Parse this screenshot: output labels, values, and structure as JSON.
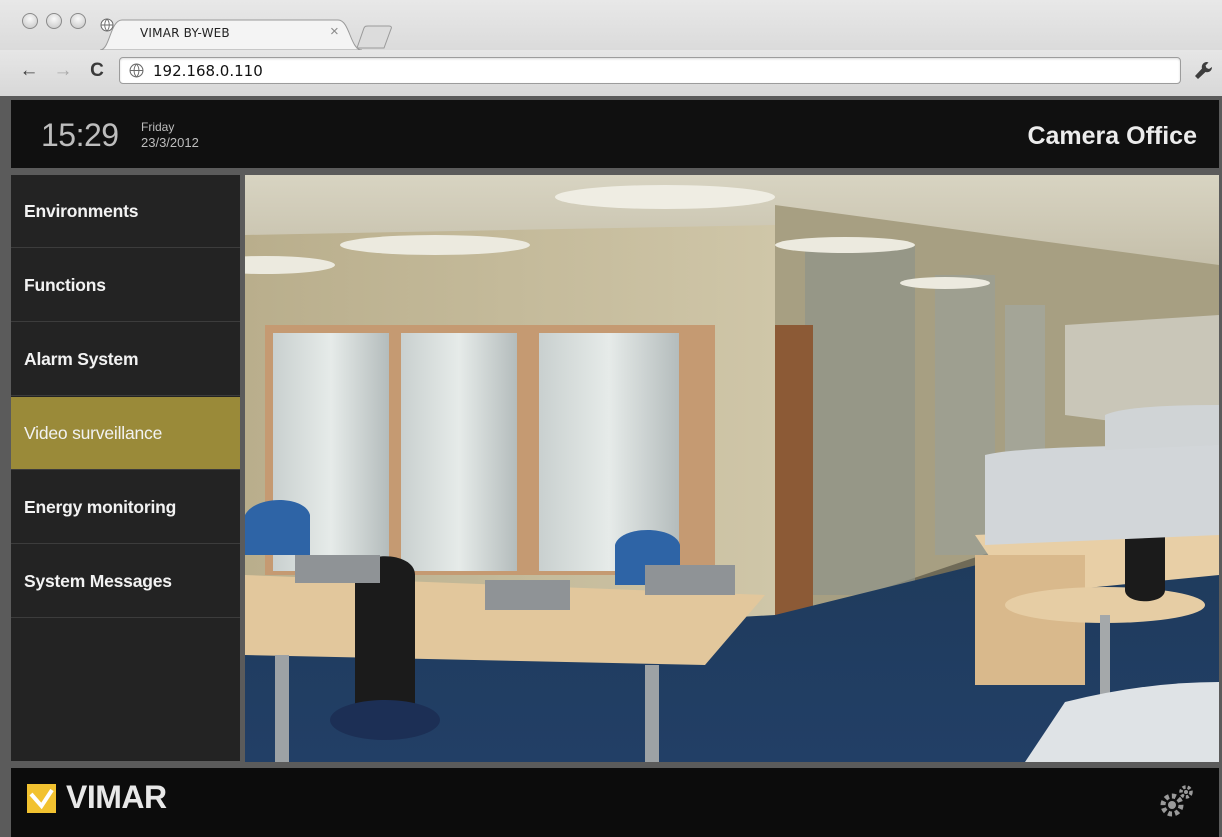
{
  "browser": {
    "tab_title": "VIMAR BY-WEB",
    "tab_close": "×",
    "url": "192.168.0.110",
    "back": "←",
    "forward": "→",
    "reload": "C",
    "icons": [
      "globe-icon",
      "wrench-icon",
      "back-arrow-icon",
      "forward-arrow-icon",
      "reload-icon"
    ]
  },
  "header": {
    "time": "15:29",
    "day": "Friday",
    "date": "23/3/2012",
    "title": "Camera Office"
  },
  "sidebar": {
    "items": [
      {
        "label": "Environments",
        "active": false
      },
      {
        "label": "Functions",
        "active": false
      },
      {
        "label": "Alarm System",
        "active": false
      },
      {
        "label": "Video surveillance",
        "active": true
      },
      {
        "label": "Energy monitoring",
        "active": false
      },
      {
        "label": "System Messages",
        "active": false
      }
    ]
  },
  "footer": {
    "brand": "VIMAR",
    "icons": [
      "vimar-logo-icon",
      "settings-gears-icon"
    ]
  },
  "colors": {
    "active_nav": "#9a8a39",
    "header_bg": "#101010",
    "sidebar_bg": "#232323",
    "logo_yellow": "#f2c230"
  }
}
